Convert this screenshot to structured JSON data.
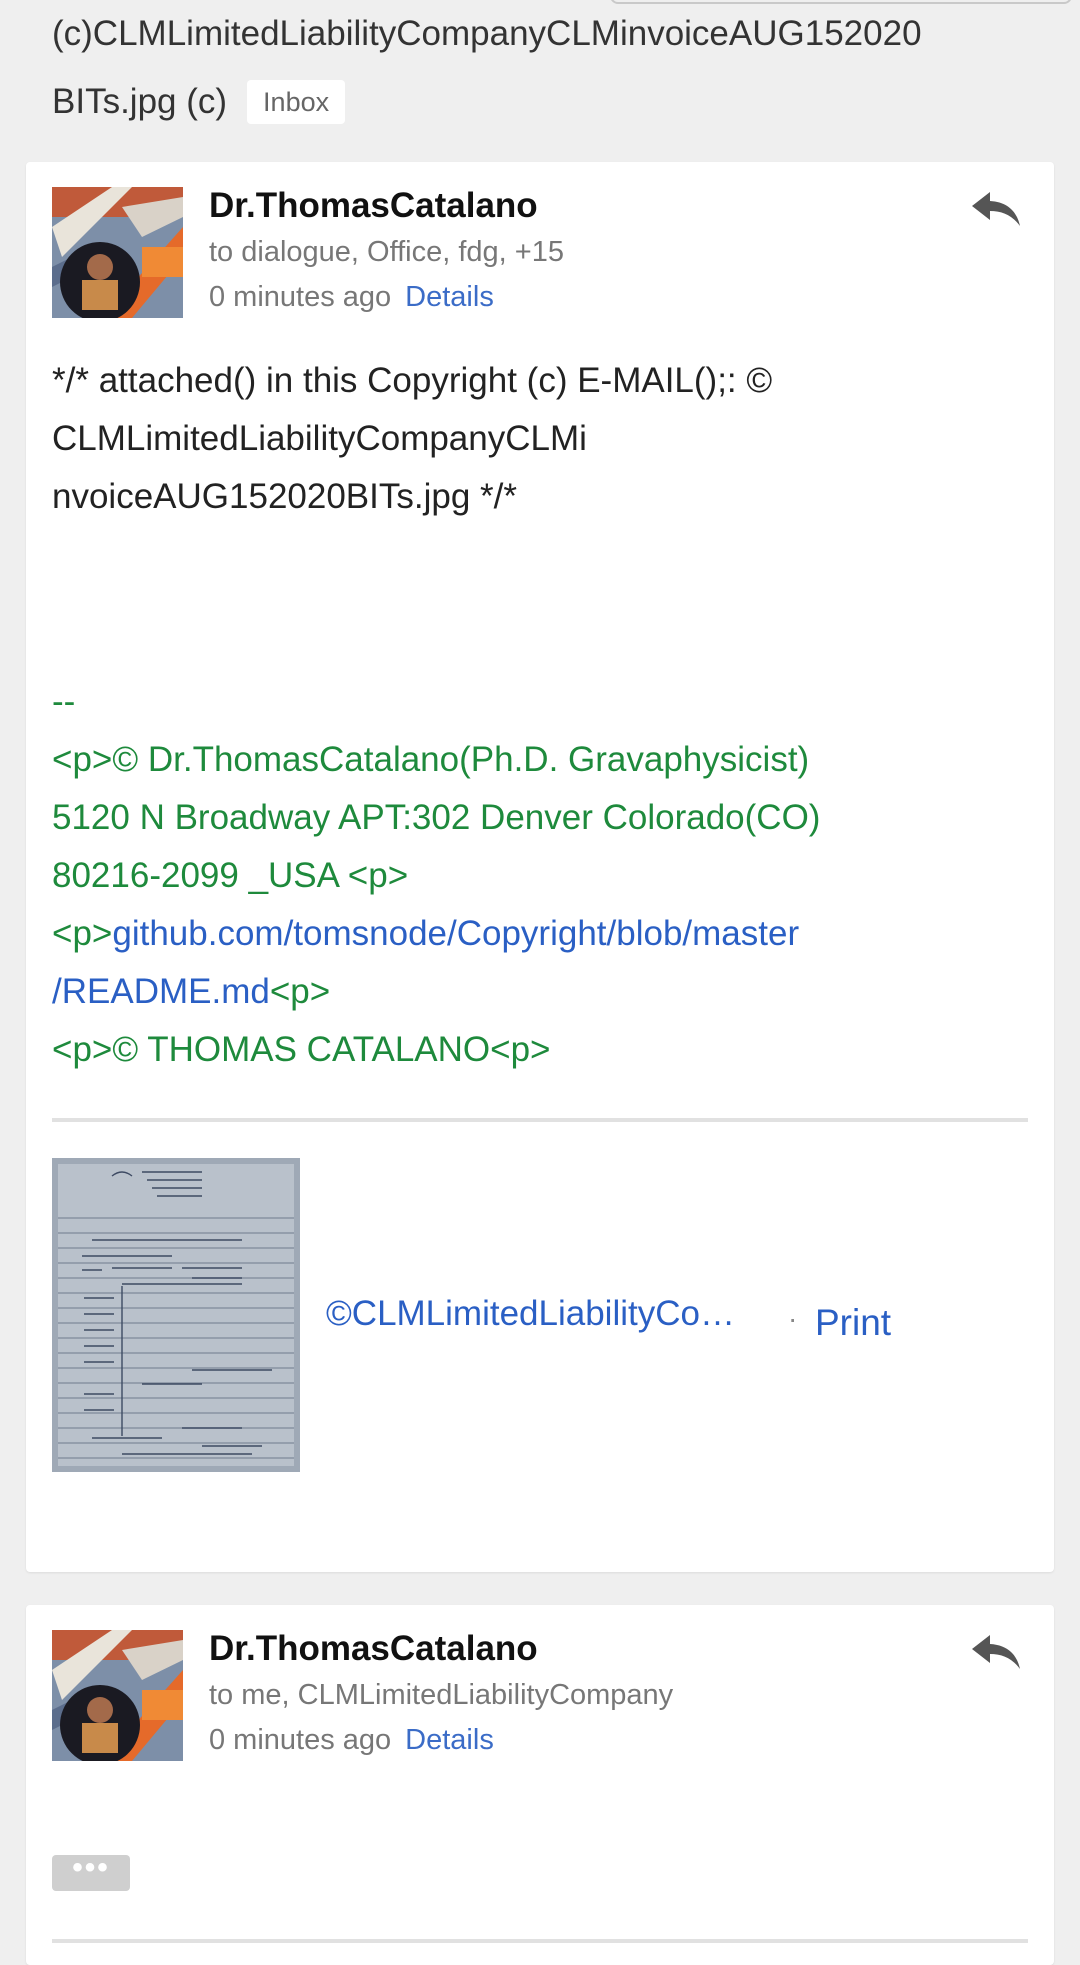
{
  "thread": {
    "subject_line1": "(c)CLMLimitedLiabilityCompanyCLMinvoiceAUG152020",
    "subject_line2": "BITs.jpg (c)",
    "label": "Inbox"
  },
  "messages": [
    {
      "sender": "Dr.ThomasCatalano",
      "recipients": "to dialogue, Office, fdg, +15",
      "time": "0 minutes ago",
      "details_label": "Details",
      "reply_icon": "reply-icon",
      "body_lines": [
        "*/* attached() in this Copyright (c) E-MAIL();: ©",
        "CLMLimitedLiabilityCompanyCLMi",
        "nvoiceAUG152020BITs.jpg */*"
      ],
      "signature": {
        "dashes": "--",
        "line1": "<p>© Dr.ThomasCatalano(Ph.D. Gravaphysicist)",
        "line2": "5120 N Broadway APT:302 Denver Colorado(CO)",
        "line3": "80216-2099 _USA <p>",
        "line4_prefix": "<p>",
        "line4_link": "github.com/tomsnode/Copyright/blob/master",
        "line5_link": "/README.md",
        "line5_suffix": "<p>",
        "line6": "<p>© THOMAS CATALANO<p>"
      },
      "attachment": {
        "name": "©CLMLimitedLiabilityCompanyCLMinvoiceAUG152020BITs.jpg",
        "separator": "·",
        "print_label": "Print"
      }
    },
    {
      "sender": "Dr.ThomasCatalano",
      "recipients": "to me, CLMLimitedLiabilityCompany",
      "time": "0 minutes ago",
      "details_label": "Details",
      "reply_icon": "reply-icon",
      "more_label": "•••"
    }
  ],
  "colors": {
    "background": "#efefef",
    "card": "#ffffff",
    "link": "#2a5fc4",
    "signature": "#1e8a3c",
    "muted": "#777777"
  }
}
